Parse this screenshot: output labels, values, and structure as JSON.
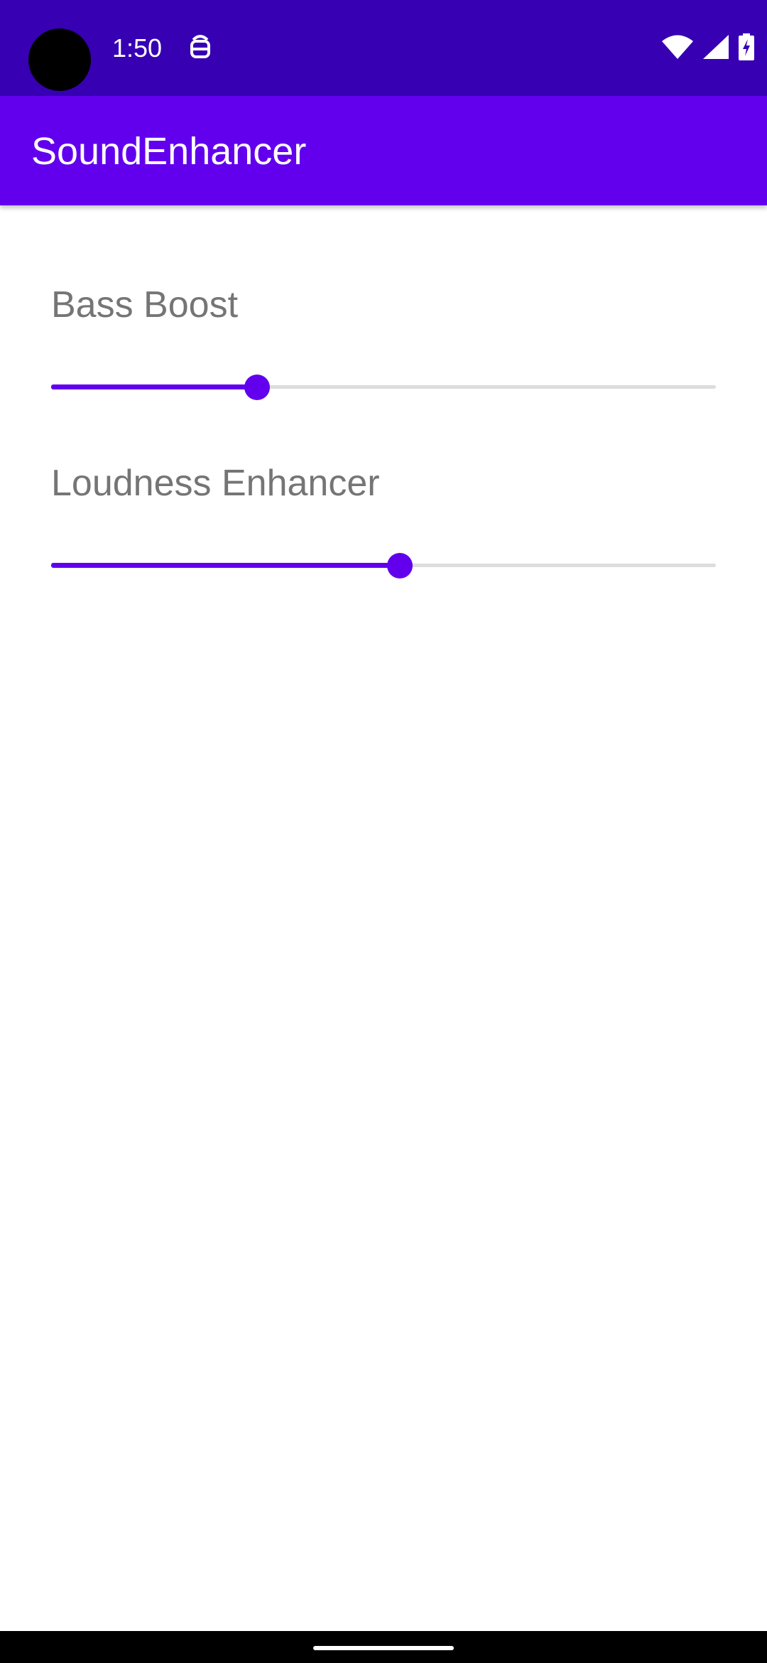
{
  "status_bar": {
    "time": "1:50",
    "notification_icon": "usb-debug-icon",
    "indicators": [
      "wifi-icon",
      "signal-icon",
      "battery-charging-icon"
    ],
    "background_color": "#3700b3"
  },
  "app_bar": {
    "title": "SoundEnhancer",
    "background_color": "#6200ee"
  },
  "settings": [
    {
      "label": "Bass Boost",
      "value": 0.31
    },
    {
      "label": "Loudness Enhancer",
      "value": 0.525
    }
  ],
  "colors": {
    "accent": "#6200ee",
    "track_inactive": "#dddddd",
    "label_text": "#757575"
  }
}
